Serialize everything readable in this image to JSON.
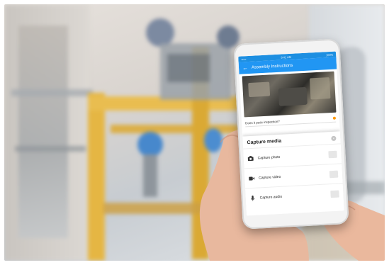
{
  "phone": {
    "status": {
      "carrier": "•••••",
      "time": "9:41 AM",
      "battery": "100%"
    },
    "app_title": "Assembly Instructions",
    "question": "Does it pass inspection?",
    "sheet": {
      "title": "Capture media",
      "options": [
        {
          "label": "Capture photo",
          "icon": "camera-icon"
        },
        {
          "label": "Capture video",
          "icon": "video-icon"
        },
        {
          "label": "Capture audio",
          "icon": "microphone-icon"
        }
      ]
    }
  },
  "colors": {
    "accent": "#2196f3",
    "status": "#ff9800"
  }
}
